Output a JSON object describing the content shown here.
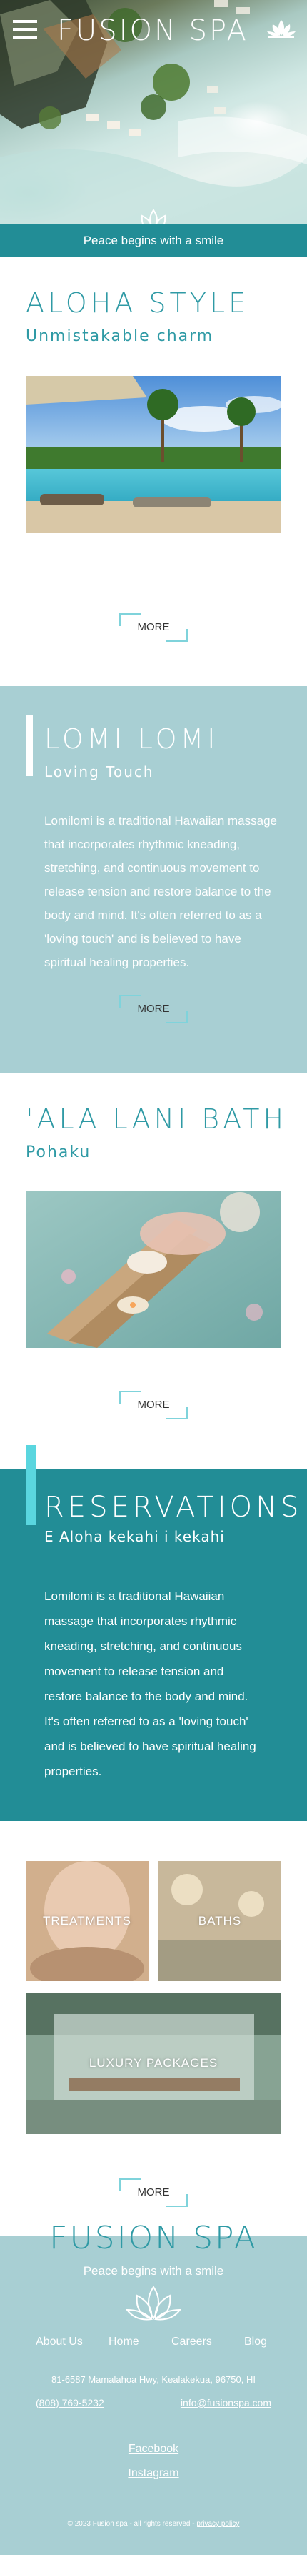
{
  "header": {
    "brand": "FUSION SPA",
    "menu_icon": "hamburger-icon",
    "logo_icon": "lotus-icon",
    "tagline": "Peace begins with a smile"
  },
  "aloha": {
    "title": "ALOHA STYLE",
    "subtitle": "Unmistakable charm",
    "more_label": "MORE"
  },
  "lomi": {
    "title": "LOMI LOMI",
    "subtitle": "Loving Touch",
    "body": "Lomilomi is a traditional Hawaiian massage that incorporates rhythmic kneading, stretching, and continuous movement to release tension and restore balance to the body and mind. It's often referred to as a 'loving touch' and is believed to have spiritual healing properties.",
    "more_label": "MORE"
  },
  "ala": {
    "title": "'ALA LANI BATH",
    "subtitle": "Pohaku",
    "more_label": "MORE"
  },
  "reservations": {
    "title": "RESERVATIONS",
    "subtitle": "E Aloha kekahi i kekahi",
    "body": "Lomilomi is a traditional Hawaiian massage that incorporates rhythmic kneading, stretching, and continuous movement to release tension and restore balance to the body and mind. It's often referred to as a 'loving touch' and is believed to have spiritual healing properties."
  },
  "services": {
    "treatments": "TREATMENTS",
    "baths": "BATHS",
    "luxury": "LUXURY PACKAGES",
    "more_label": "MORE"
  },
  "footer": {
    "brand": "FUSION SPA",
    "tagline": "Peace begins with a smile",
    "nav": [
      "About Us",
      "Home",
      "Careers",
      "Blog"
    ],
    "address": "81-6587 Mamalahoa Hwy, Kealakekua, 96750, HI",
    "phone": "(808) 769-5232",
    "email": "info@fusionspa.com",
    "facebook": "Facebook",
    "instagram": "Instagram",
    "copyright": "©   2023 Fusion spa - all rights reserved",
    "privacy": "privacy policy"
  },
  "colors": {
    "teal": "#228d96",
    "light_teal": "#a8cfd3",
    "title_teal": "#2f9aa5",
    "accent_cyan": "#5ad6df"
  }
}
